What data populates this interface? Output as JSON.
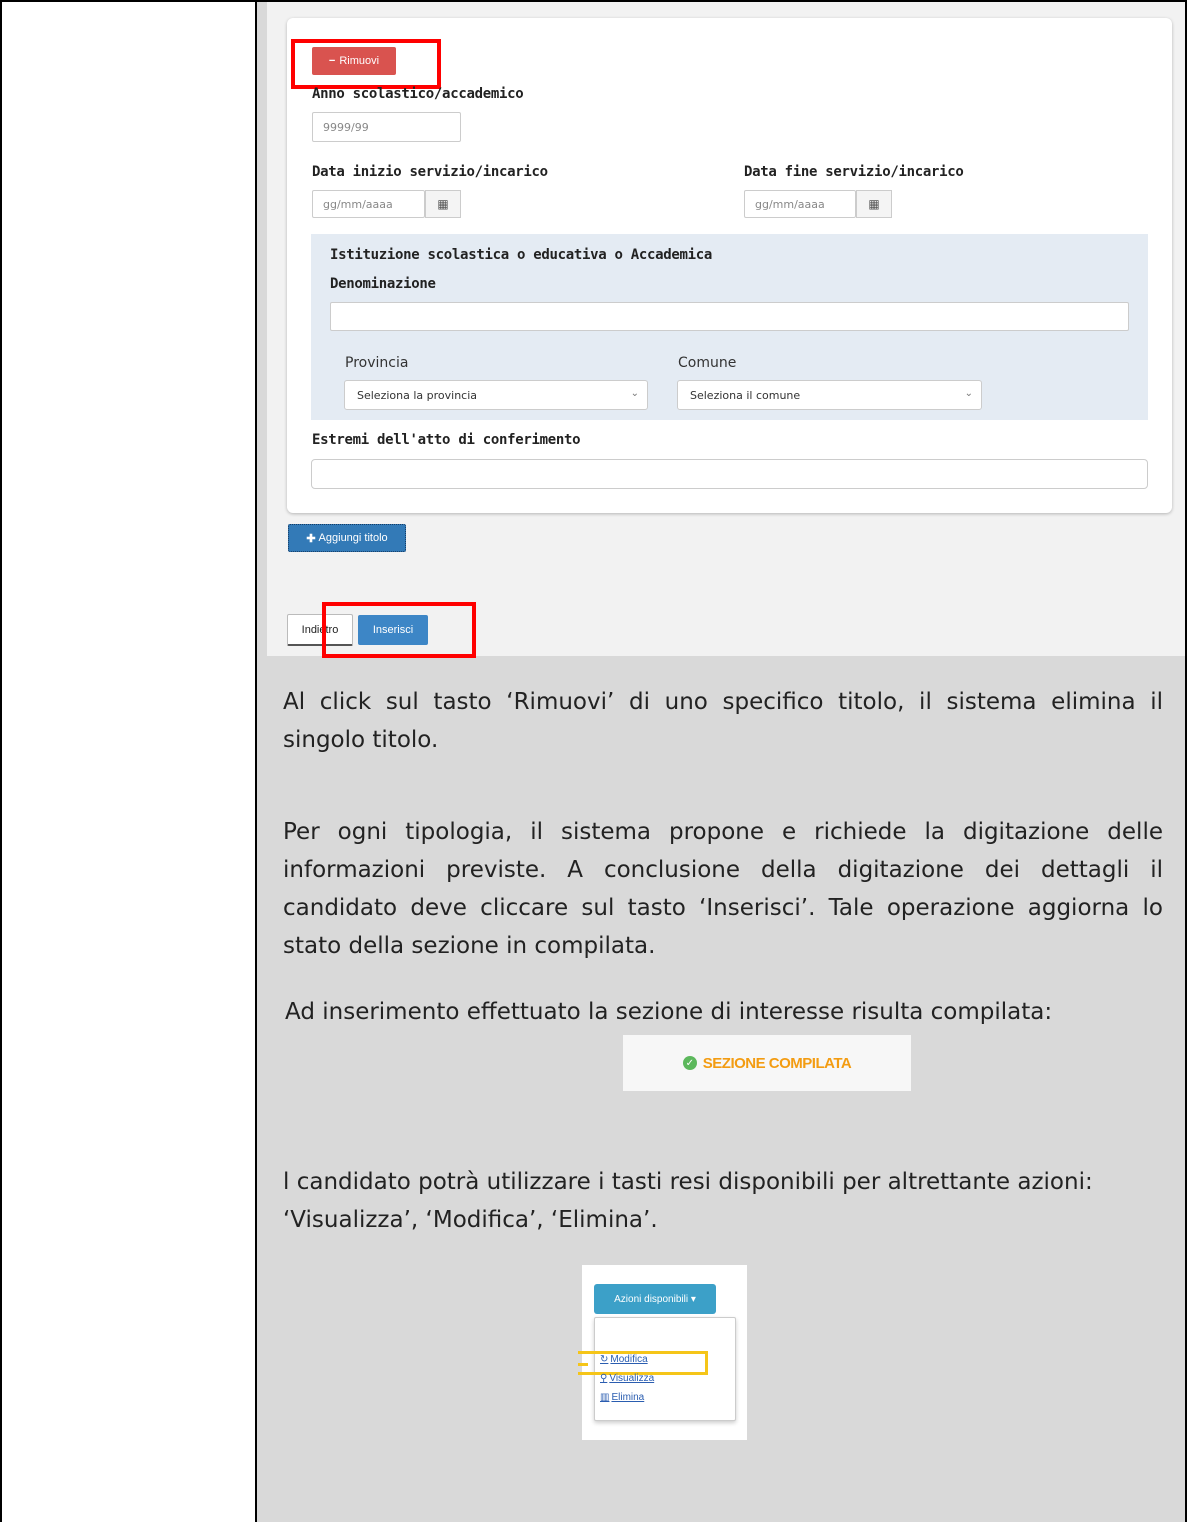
{
  "form": {
    "remove_label": "Rimuovi",
    "year_label": "Anno scolastico/accademico",
    "year_placeholder": "9999/99",
    "start_label": "Data inizio servizio/incarico",
    "start_placeholder": "gg/mm/aaaa",
    "end_label": "Data fine servizio/incarico",
    "end_placeholder": "gg/mm/aaaa",
    "institution_title": "Istituzione scolastica o educativa o Accademica",
    "denominazione_label": "Denominazione",
    "provincia_label": "Provincia",
    "provincia_value": "Seleziona la provincia",
    "comune_label": "Comune",
    "comune_value": "Seleziona il comune",
    "estremi_label": "Estremi dell'atto di conferimento",
    "add_title_label": "Aggiungi titolo",
    "back_label": "Indietro",
    "insert_label": "Inserisci"
  },
  "text": {
    "p1": "Al click sul tasto ‘Rimuovi’ di uno specifico titolo, il sistema elimina il singolo titolo.",
    "p2": "Per ogni tipologia, il sistema propone e richiede la digitazione delle informazioni previste. A conclusione della digitazione dei dettagli il candidato deve cliccare sul tasto ‘Inserisci’. Tale operazione aggiorna lo stato della sezione in compilata.",
    "p3": "Ad inserimento effettuato la sezione di interesse risulta compilata:",
    "p4": "l candidato potrà utilizzare i tasti resi disponibili per altrettante azioni: ‘Visualizza’, ‘Modifica’, ‘Elimina’."
  },
  "badge": {
    "label": "SEZIONE COMPILATA",
    "color": "#f39c12"
  },
  "actions_menu": {
    "button_label": "Azioni disponibili ▾",
    "items": [
      "Modifica",
      "Visualizza",
      "Elimina"
    ]
  },
  "colors": {
    "remove": "#d9534f",
    "primary": "#337ab7",
    "highlight_red": "#ff0000",
    "highlight_yellow": "#f5c518"
  }
}
